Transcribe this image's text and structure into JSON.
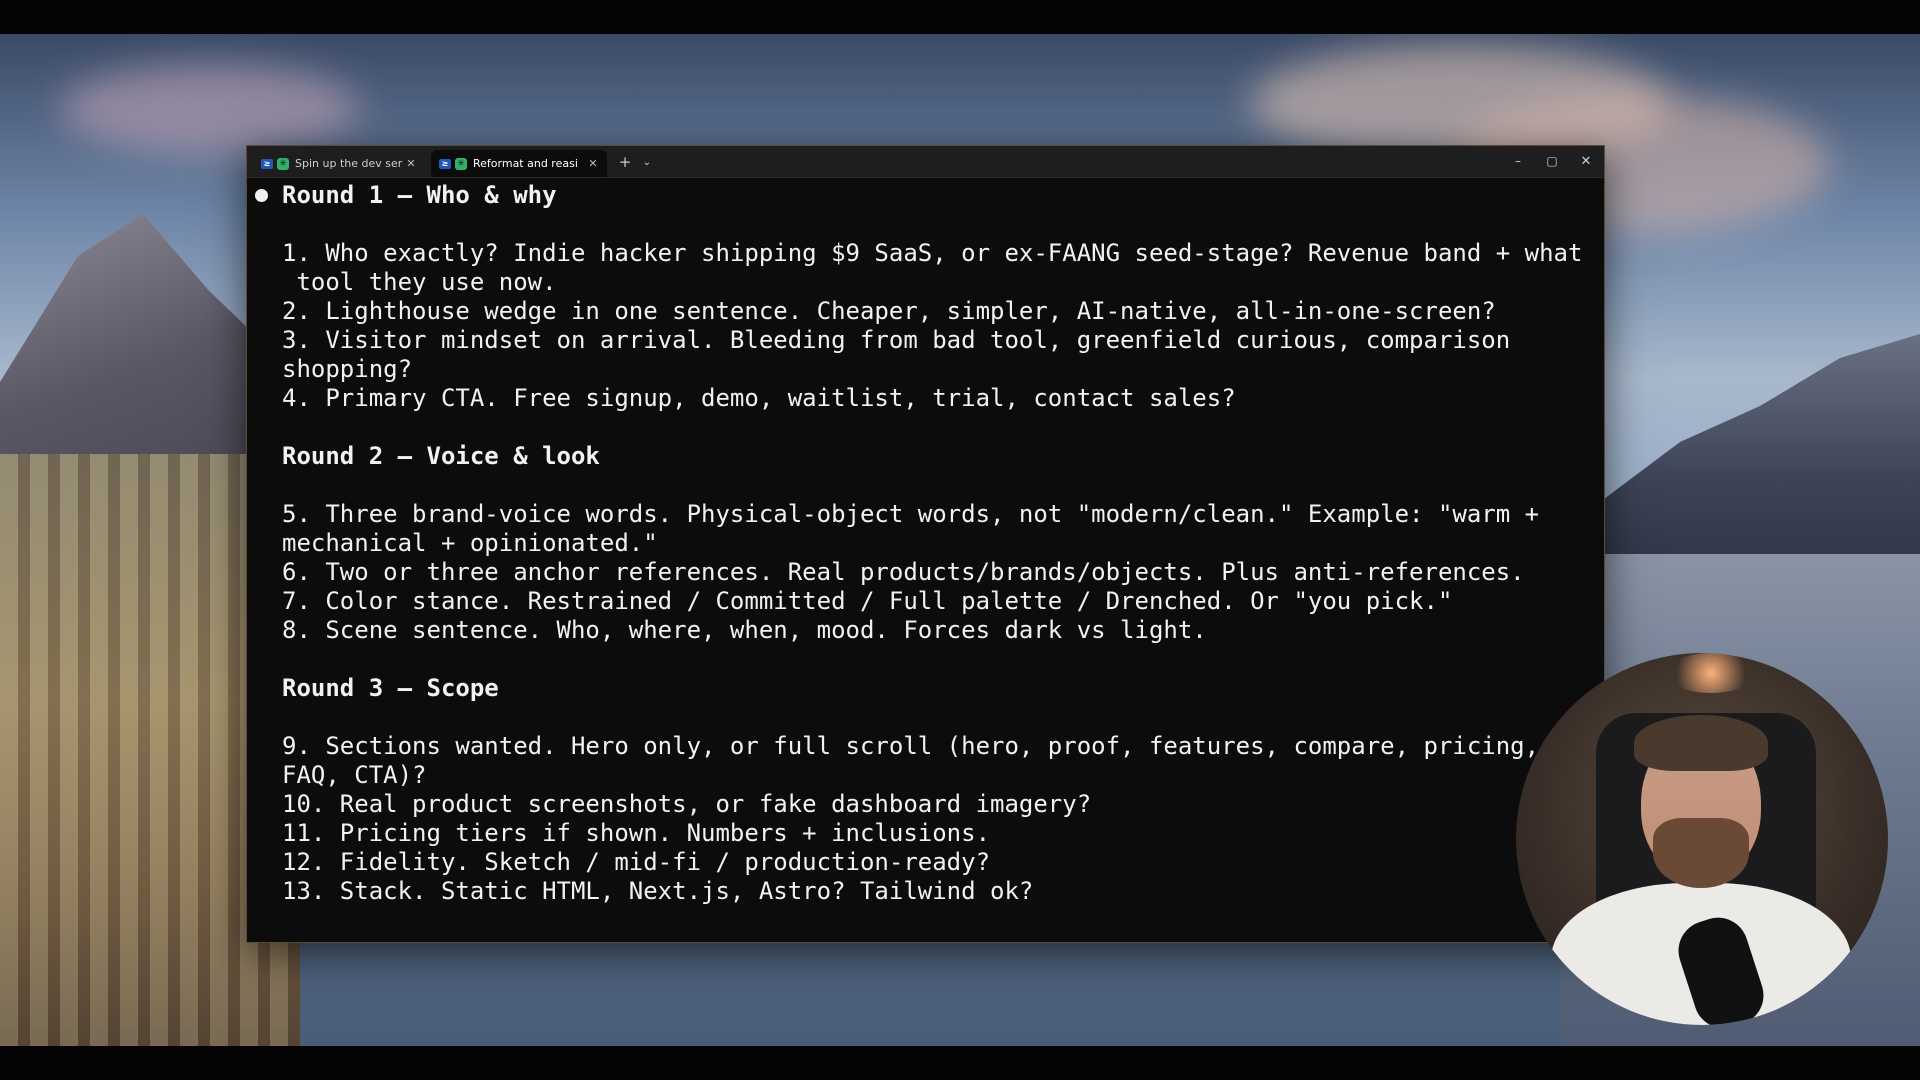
{
  "terminal": {
    "tabs": [
      {
        "label": "Spin up the dev ser",
        "active": false
      },
      {
        "label": "Reformat and reasi",
        "active": true
      }
    ],
    "new_tab_label": "+",
    "tab_menu_label": "⌄",
    "window_controls": {
      "minimize": "–",
      "maximize": "▢",
      "close": "✕"
    },
    "tab_close_glyph": "✕",
    "tab_icon_text": "≥",
    "lines": [
      "Round 1 — Who & why",
      "1. Who exactly? Indie hacker shipping $9 SaaS, or ex-FAANG seed-stage? Revenue band + what",
      " tool they use now.",
      "2. Lighthouse wedge in one sentence. Cheaper, simpler, AI-native, all-in-one-screen?",
      "3. Visitor mindset on arrival. Bleeding from bad tool, greenfield curious, comparison",
      "shopping?",
      "4. Primary CTA. Free signup, demo, waitlist, trial, contact sales?",
      "Round 2 — Voice & look",
      "5. Three brand-voice words. Physical-object words, not \"modern/clean.\" Example: \"warm +",
      "mechanical + opinionated.\"",
      "6. Two or three anchor references. Real products/brands/objects. Plus anti-references.",
      "7. Color stance. Restrained / Committed / Full palette / Drenched. Or \"you pick.\"",
      "8. Scene sentence. Who, where, when, mood. Forces dark vs light.",
      "Round 3 — Scope",
      "9. Sections wanted. Hero only, or full scroll (hero, proof, features, compare, pricing,",
      "FAQ, CTA)?",
      "10. Real product screenshots, or fake dashboard imagery?",
      "11. Pricing tiers if shown. Numbers + inclusions.",
      "12. Fidelity. Sketch / mid-fi / production-ready?",
      "13. Stack. Static HTML, Next.js, Astro? Tailwind ok?"
    ]
  },
  "colors": {
    "terminal_bg": "#0c0c0c",
    "terminal_text": "#f2f2f2",
    "titlebar_bg": "#1e1e1e",
    "tab_icon_green": "#2fb36b",
    "tab_icon_blue": "#2458b8"
  }
}
